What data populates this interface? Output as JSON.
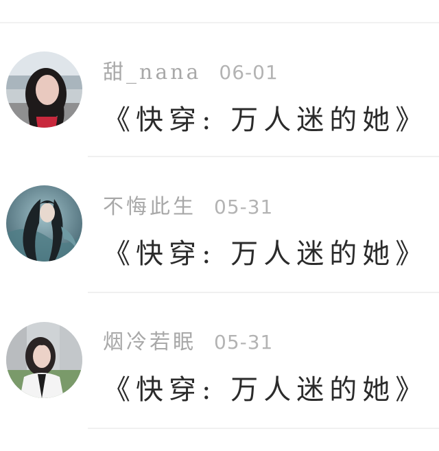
{
  "comments": [
    {
      "username": "甜_nana",
      "date": "06-01",
      "message": "《快穿: 万人迷的她》",
      "avatar": "avatar-photo-woman-long-hair"
    },
    {
      "username": "不悔此生",
      "date": "05-31",
      "message": "《快穿: 万人迷的她》",
      "avatar": "avatar-illustration-long-haired-figure"
    },
    {
      "username": "烟冷若眠",
      "date": "05-31",
      "message": "《快穿: 万人迷的她》",
      "avatar": "avatar-photo-woman-short-hair"
    }
  ],
  "colors": {
    "username": "#a8a8a8",
    "date": "#b3b3b3",
    "message": "#2b2b2b",
    "divider": "#f0f0f0"
  }
}
